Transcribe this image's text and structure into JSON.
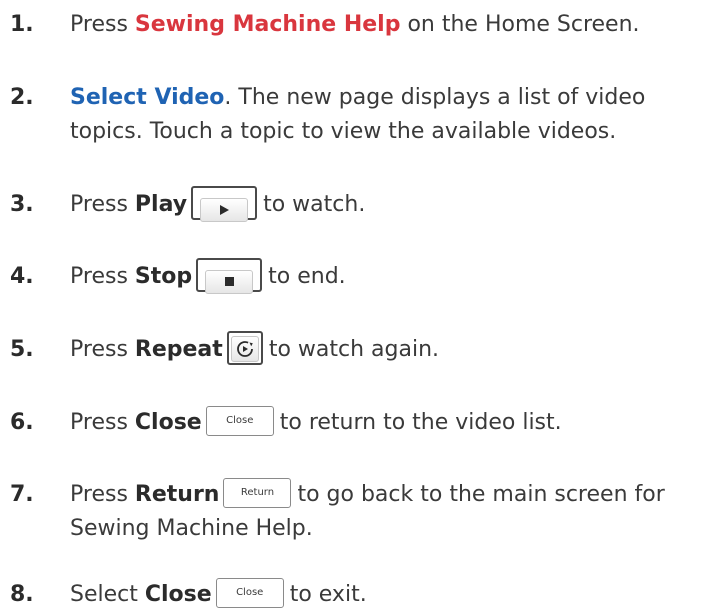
{
  "steps": [
    {
      "num": "1.",
      "pre": "Press ",
      "emph": "Sewing Machine Help",
      "post": " on the Home Screen."
    },
    {
      "num": "2.",
      "emph": "Select Video",
      "post": ". The new page displays a list of video topics. Touch a topic to view the available videos."
    },
    {
      "num": "3.",
      "pre": "Press ",
      "emph": "Play",
      "icon": "play-icon",
      "post": "to watch."
    },
    {
      "num": "4.",
      "pre": "Press ",
      "emph": "Stop",
      "icon": "stop-icon",
      "post": "to end."
    },
    {
      "num": "5.",
      "pre": "Press ",
      "emph": "Repeat",
      "icon": "repeat-icon",
      "post": "to watch again."
    },
    {
      "num": "6.",
      "pre": "Press ",
      "emph": "Close",
      "button_label": "Close",
      "post": "to return to the video list."
    },
    {
      "num": "7.",
      "pre": "Press ",
      "emph": "Return",
      "button_label": "Return",
      "post": "to go back to the main screen for Sewing Machine Help."
    },
    {
      "num": "8.",
      "pre": "Select ",
      "emph": "Close",
      "button_label": "Close",
      "post": "to exit."
    }
  ],
  "colors": {
    "red_emphasis": "#d9363e",
    "blue_emphasis": "#1f63b3",
    "body_text": "#3a3a3a"
  }
}
